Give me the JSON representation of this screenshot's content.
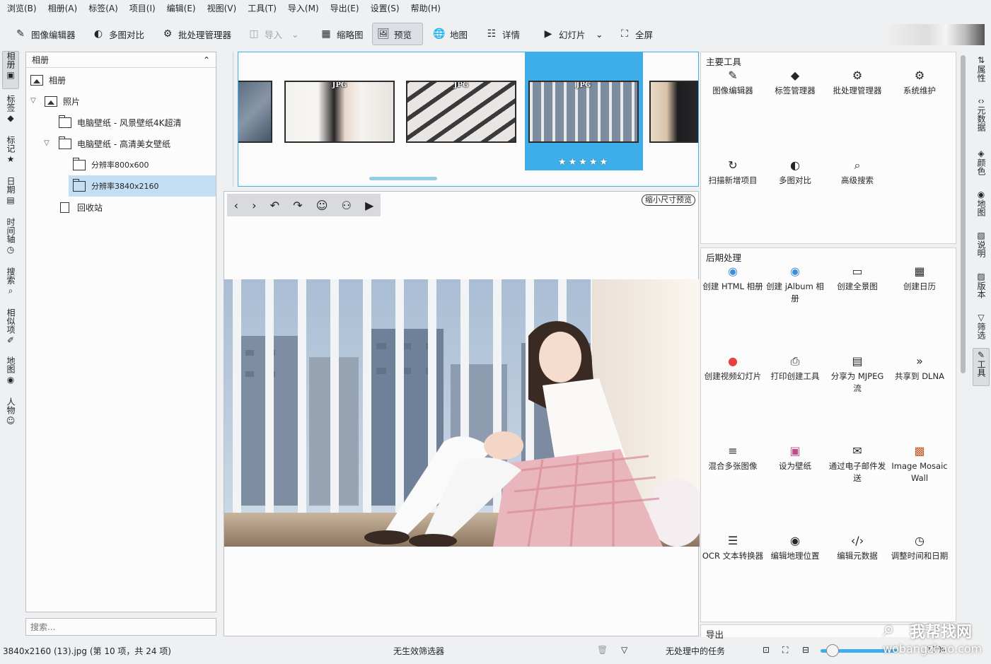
{
  "menu": [
    "浏览(B)",
    "相册(A)",
    "标签(A)",
    "项目(I)",
    "编辑(E)",
    "视图(V)",
    "工具(T)",
    "导入(M)",
    "导出(E)",
    "设置(S)",
    "帮助(H)"
  ],
  "toolbar": {
    "image_editor": "图像编辑器",
    "compare": "多图对比",
    "batch": "批处理管理器",
    "import": "导入",
    "thumbnail": "缩略图",
    "preview": "预览",
    "map": "地图",
    "details": "详情",
    "slideshow": "幻灯片",
    "fullscreen": "全屏"
  },
  "left_tabs": [
    "相册",
    "标签",
    "标记",
    "日期",
    "时间轴",
    "搜索",
    "相似项",
    "地图",
    "人物"
  ],
  "album_panel": {
    "header": "相册",
    "tree": [
      "相册",
      "照片",
      "电脑壁纸 - 风景壁纸4K超清",
      "电脑壁纸 - 高清美女壁纸",
      "分辨率800x600",
      "分辨率3840x2160",
      "回收站"
    ],
    "search_placeholder": "搜索..."
  },
  "thumbnails": {
    "badge": "JPG",
    "stars": "★★★★★"
  },
  "preview": {
    "shrink_label": "缩小尺寸预览"
  },
  "tools": {
    "main_title": "主要工具",
    "main": [
      "图像编辑器",
      "标签管理器",
      "批处理管理器",
      "系统维护",
      "扫描新增项目",
      "多图对比",
      "高级搜索"
    ],
    "post_title": "后期处理",
    "post": [
      "创建 HTML 相册",
      "创建 jAlbum 相册",
      "创建全景图",
      "创建日历",
      "创建视频幻灯片",
      "打印创建工具",
      "分享为 MJPEG 流",
      "共享到 DLNA",
      "混合多张图像",
      "设为壁纸",
      "通过电子邮件发送",
      "Image Mosaic Wall",
      "OCR 文本转换器",
      "编辑地理位置",
      "编辑元数据",
      "调整时间和日期"
    ],
    "export_title": "导出"
  },
  "right_tabs": [
    "属性",
    "元数据",
    "颜色",
    "地图",
    "说明",
    "版本",
    "筛选",
    "工具"
  ],
  "status": {
    "file": "3840x2160 (13).jpg (第 10 项，共 24 项)",
    "filter": "无生效筛选器",
    "tasks": "无处理中的任务",
    "zoom": "17%"
  },
  "watermark": {
    "site": "我帮找网",
    "url": "wobangzhao.com"
  },
  "colors": {
    "accent": "#3daee9",
    "selection": "#c4def3",
    "rating": "#e94040"
  }
}
